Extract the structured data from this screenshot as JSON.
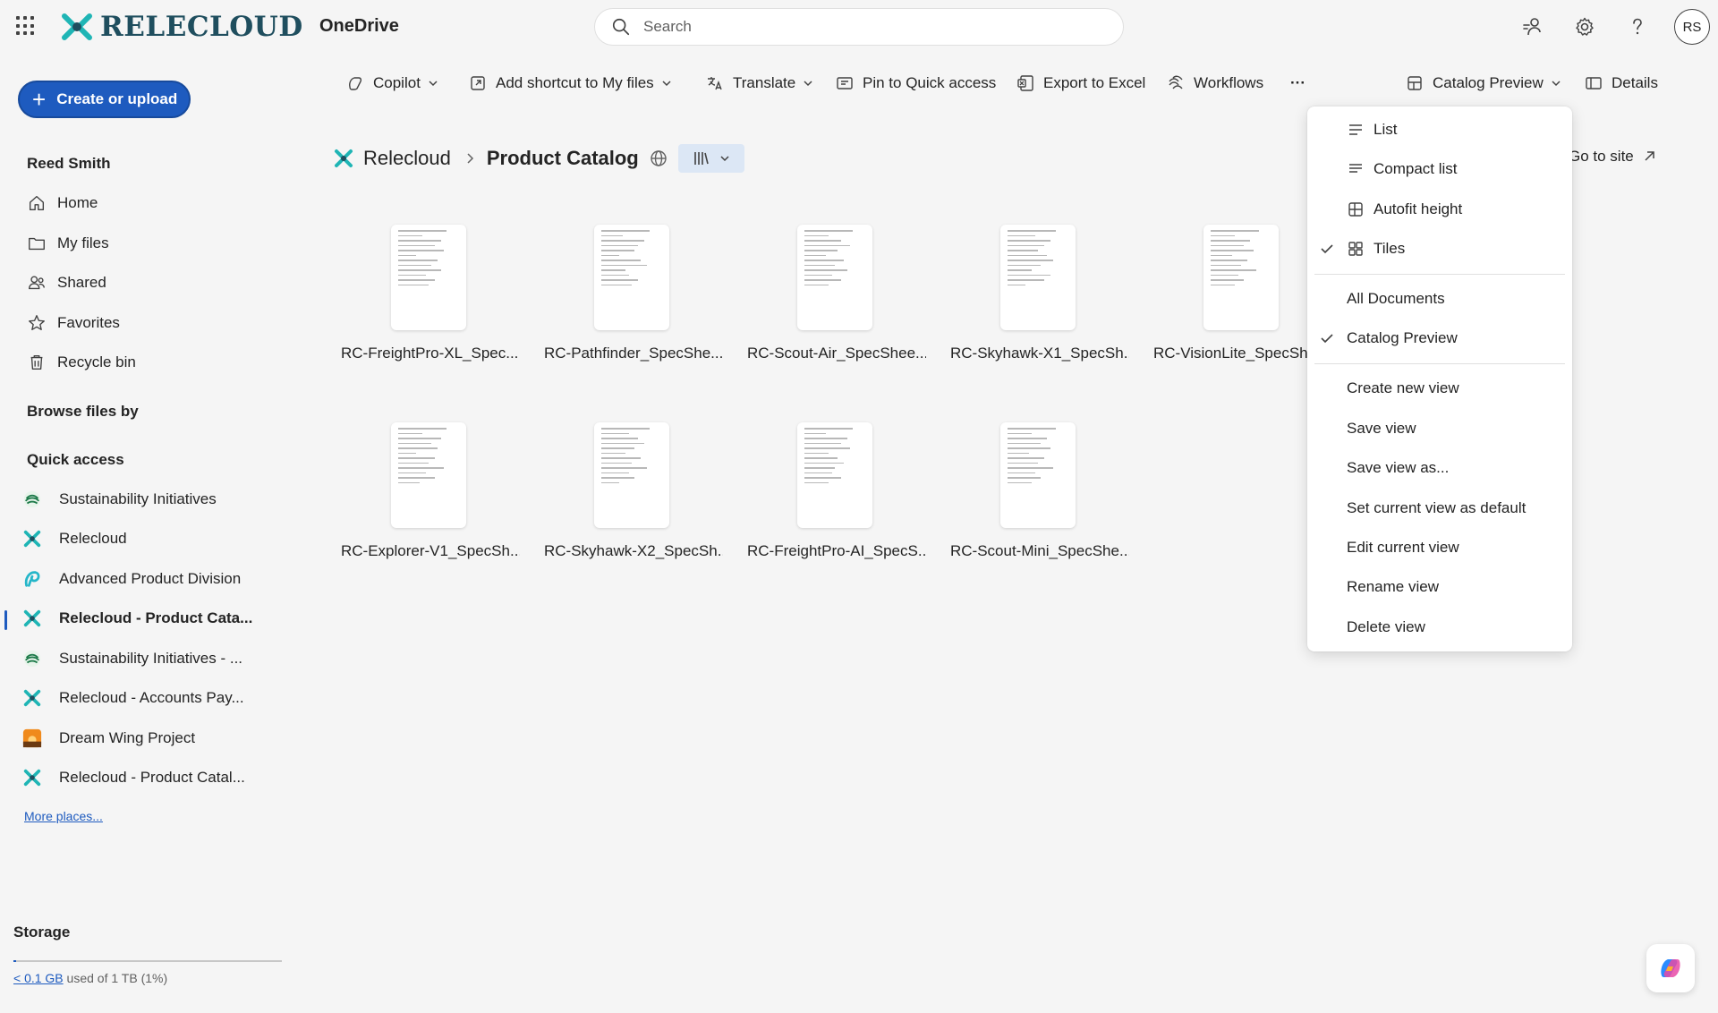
{
  "topbar": {
    "brand": "RELECLOUD",
    "app_name": "OneDrive",
    "search_placeholder": "Search",
    "avatar_initials": "RS"
  },
  "sidebar": {
    "create_label": "Create or upload",
    "user_name": "Reed Smith",
    "nav": [
      {
        "label": "Home",
        "icon": "home-icon"
      },
      {
        "label": "My files",
        "icon": "folder-icon"
      },
      {
        "label": "Shared",
        "icon": "people-icon"
      },
      {
        "label": "Favorites",
        "icon": "star-icon"
      },
      {
        "label": "Recycle bin",
        "icon": "trash-icon"
      }
    ],
    "browse_heading": "Browse files by",
    "quick_access_heading": "Quick access",
    "quick_access": [
      {
        "label": "Sustainability Initiatives",
        "icon": "sustainability-site-icon"
      },
      {
        "label": "Relecloud",
        "icon": "relecloud-site-icon"
      },
      {
        "label": "Advanced Product Division",
        "icon": "advanced-product-site-icon"
      },
      {
        "label": "Relecloud - Product Cata...",
        "icon": "relecloud-site-icon",
        "active": true
      },
      {
        "label": "Sustainability Initiatives - ...",
        "icon": "sustainability-site-icon"
      },
      {
        "label": "Relecloud - Accounts Pay...",
        "icon": "relecloud-site-icon"
      },
      {
        "label": "Dream Wing Project",
        "icon": "dream-wing-site-icon"
      },
      {
        "label": "Relecloud - Product Catal...",
        "icon": "relecloud-site-icon"
      }
    ],
    "more_places": "More places...",
    "storage": {
      "label": "Storage",
      "used": "< 0.1 GB",
      "rest": "used of 1 TB (1%)",
      "fraction": 0.01
    }
  },
  "commands": {
    "copilot": "Copilot",
    "add_shortcut": "Add shortcut to My files",
    "translate": "Translate",
    "pin": "Pin to Quick access",
    "export": "Export to Excel",
    "workflows": "Workflows",
    "more": "···",
    "view": "Catalog Preview",
    "details": "Details"
  },
  "breadcrumb": {
    "root": "Relecloud",
    "current": "Product Catalog",
    "go_to_site": "Go to site"
  },
  "files": [
    "RC-FreightPro-XL_Spec...",
    "RC-Pathfinder_SpecShe...",
    "RC-Scout-Air_SpecShee...",
    "RC-Skyhawk-X1_SpecSh...",
    "RC-VisionLite_SpecShe",
    "RC-Explorer-V1_SpecSh...",
    "RC-Skyhawk-X2_SpecSh...",
    "RC-FreightPro-AI_SpecS...",
    "RC-Scout-Mini_SpecShe..."
  ],
  "view_menu": {
    "layouts": [
      {
        "label": "List",
        "icon": "list-icon",
        "checked": false
      },
      {
        "label": "Compact list",
        "icon": "compact-list-icon",
        "checked": false
      },
      {
        "label": "Autofit height",
        "icon": "autofit-height-icon",
        "checked": false
      },
      {
        "label": "Tiles",
        "icon": "tiles-icon",
        "checked": true
      }
    ],
    "views": [
      {
        "label": "All Documents",
        "checked": false
      },
      {
        "label": "Catalog Preview",
        "checked": true
      }
    ],
    "actions": [
      "Create new view",
      "Save view",
      "Save view as...",
      "Set current view as default",
      "Edit current view",
      "Rename view",
      "Delete view"
    ]
  },
  "colors": {
    "accent": "#1e5bbf",
    "brand_teal": "#1f4e5e",
    "background": "#f5f5f5"
  }
}
